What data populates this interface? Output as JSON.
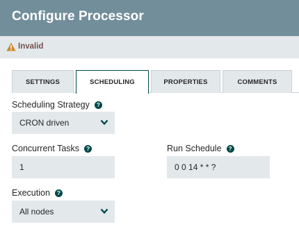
{
  "dialog": {
    "title": "Configure Processor"
  },
  "status": {
    "label": "Invalid",
    "icon": "warning-icon",
    "icon_color": "#c88a2e"
  },
  "tabs": [
    {
      "label": "SETTINGS",
      "active": false
    },
    {
      "label": "SCHEDULING",
      "active": true
    },
    {
      "label": "PROPERTIES",
      "active": false
    },
    {
      "label": "COMMENTS",
      "active": false
    }
  ],
  "scheduling_strategy": {
    "label": "Scheduling Strategy",
    "value": "CRON driven"
  },
  "concurrent_tasks": {
    "label": "Concurrent Tasks",
    "value": "1"
  },
  "run_schedule": {
    "label": "Run Schedule",
    "value": "0 0 14 * * ?"
  },
  "execution": {
    "label": "Execution",
    "value": "All nodes"
  },
  "help_glyph": "?",
  "colors": {
    "header": "#728e9b",
    "accent": "#004849",
    "field_bg": "#e3e8eb",
    "status_text": "#775351"
  }
}
